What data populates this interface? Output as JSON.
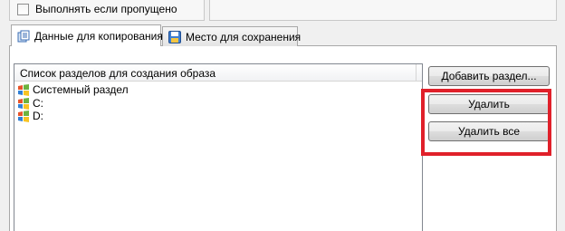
{
  "options": {
    "skip_checkbox_label": "Выполнять если пропущено",
    "skip_checkbox_checked": false
  },
  "tabs": [
    {
      "label": "Данные для копирования",
      "icon": "copy-data-icon",
      "active": true
    },
    {
      "label": "Место для сохранения",
      "icon": "save-location-icon",
      "active": false
    }
  ],
  "partition_list": {
    "header": "Список разделов для создания образа",
    "items": [
      {
        "label": "Системный раздел",
        "icon": "windows-partition-icon"
      },
      {
        "label": "C:",
        "icon": "windows-partition-icon"
      },
      {
        "label": "D:",
        "icon": "windows-partition-icon"
      }
    ]
  },
  "buttons": {
    "add_partition": "Добавить раздел...",
    "delete": "Удалить",
    "delete_all": "Удалить все"
  },
  "highlight_color": "#e0202a"
}
